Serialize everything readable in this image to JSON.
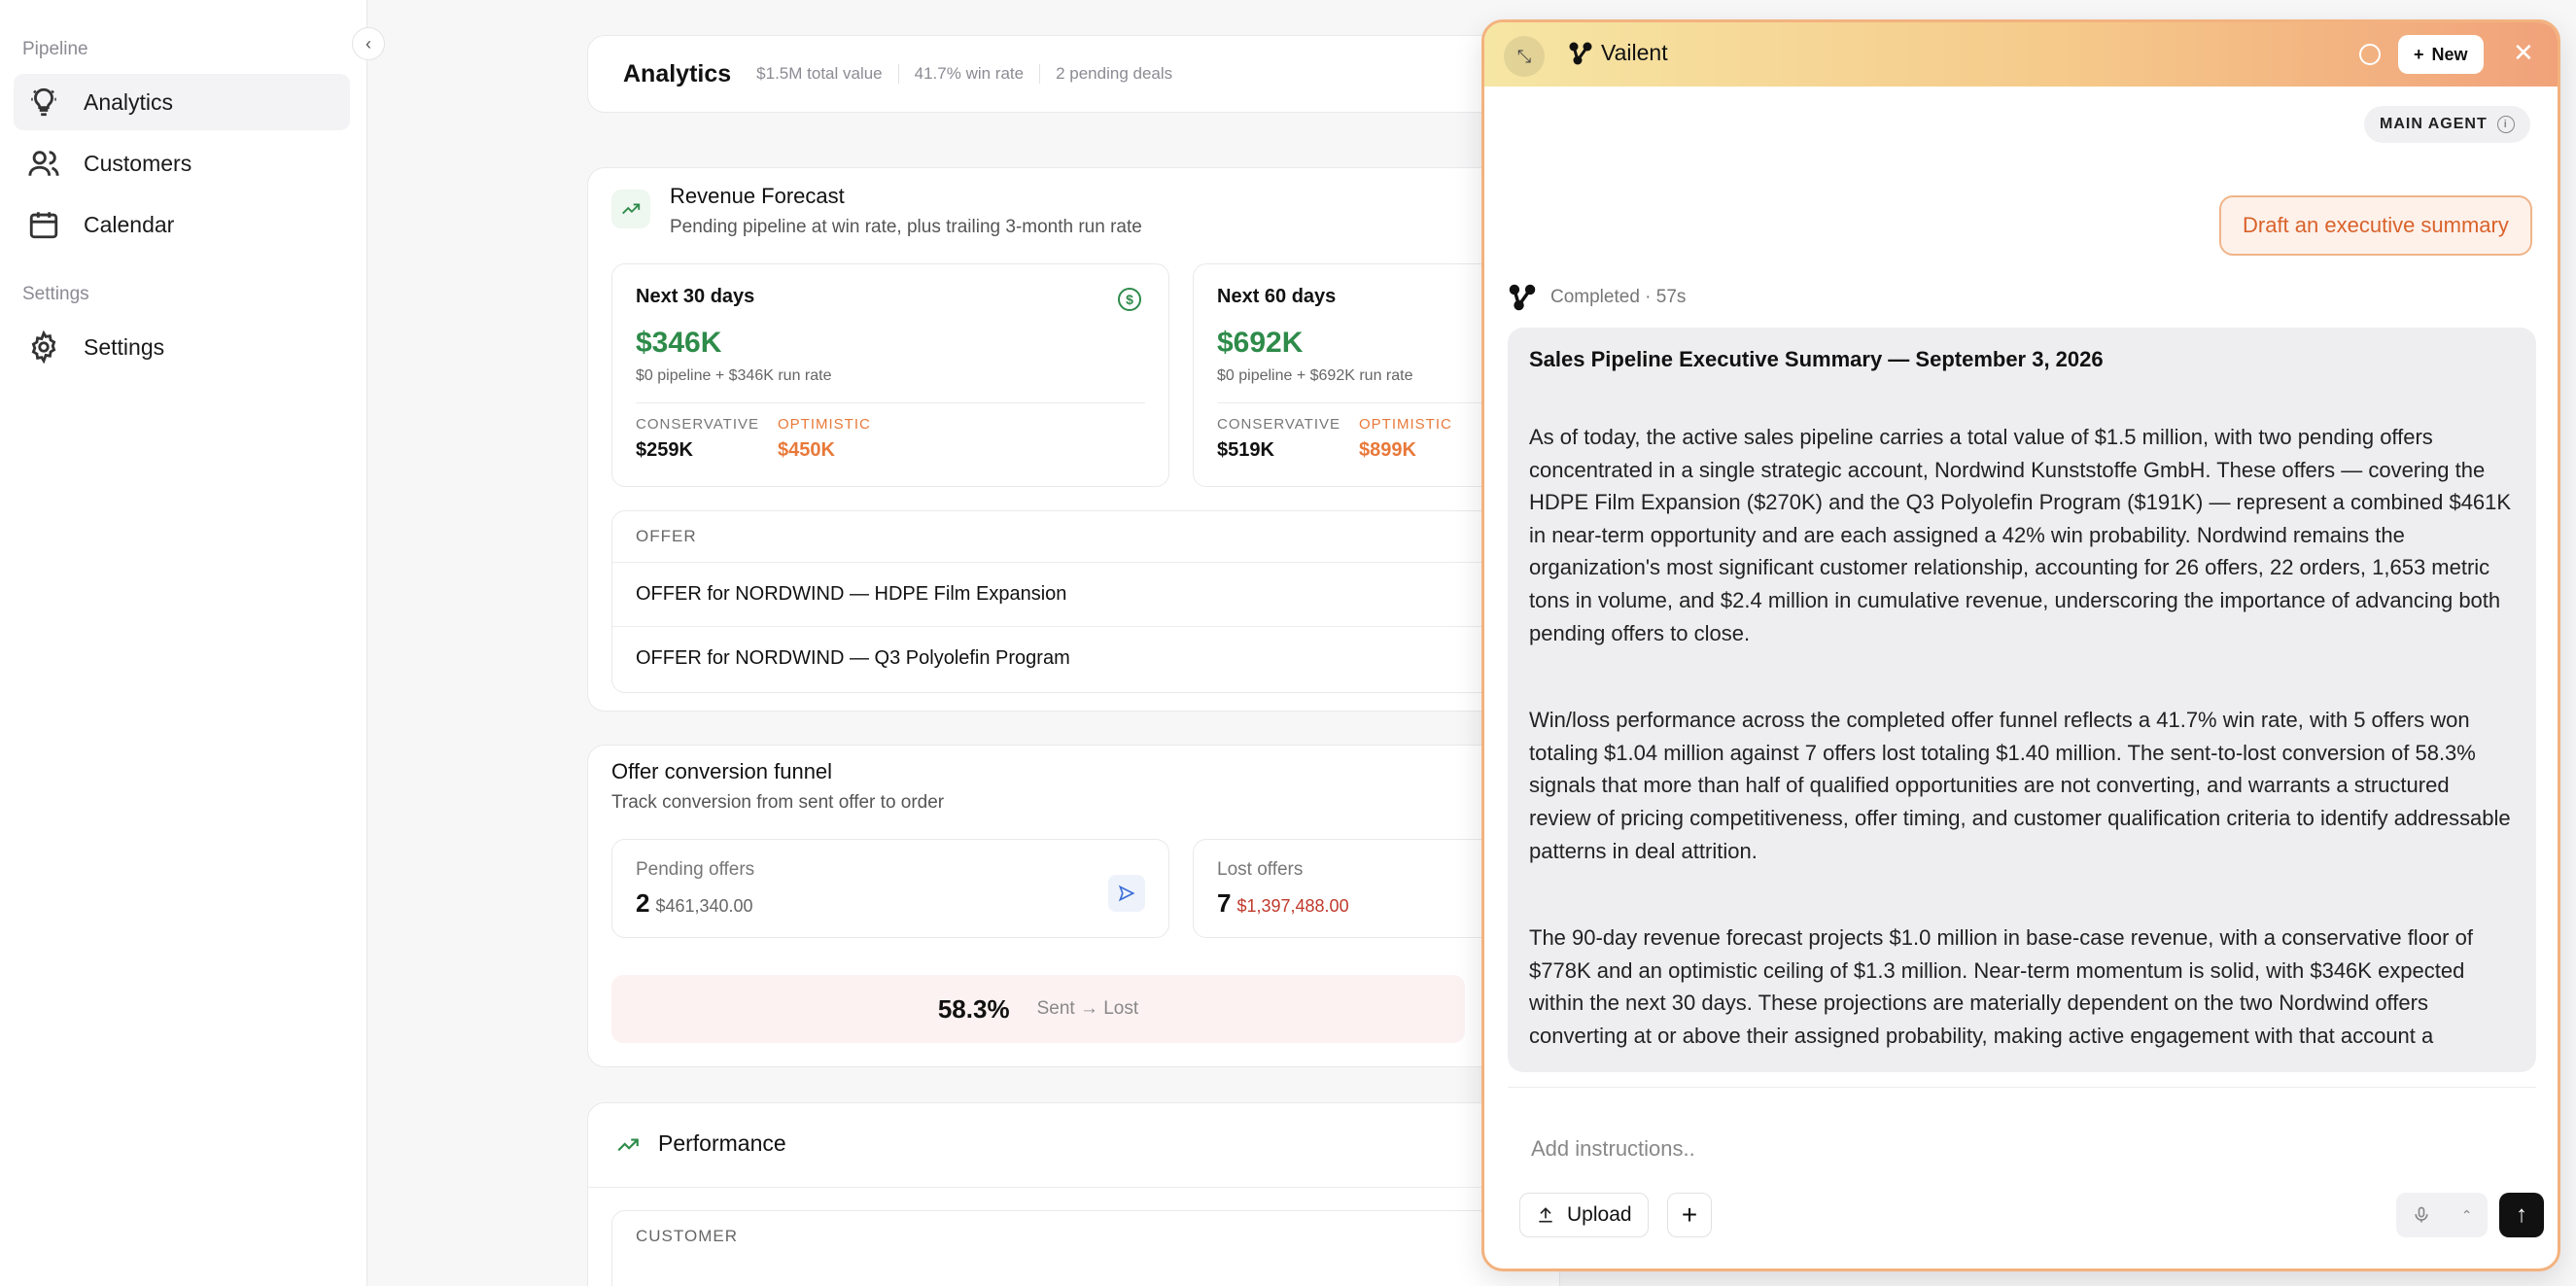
{
  "sidebar": {
    "section_pipeline": "Pipeline",
    "section_settings": "Settings",
    "items": [
      {
        "label": "Analytics",
        "icon": "lightbulb-icon"
      },
      {
        "label": "Customers",
        "icon": "users-icon"
      },
      {
        "label": "Calendar",
        "icon": "calendar-icon"
      },
      {
        "label": "Settings",
        "icon": "gear-icon"
      }
    ]
  },
  "header": {
    "title": "Analytics",
    "meta": [
      "$1.5M total value",
      "41.7% win rate",
      "2 pending deals"
    ]
  },
  "forecast": {
    "title": "Revenue Forecast",
    "subtitle": "Pending pipeline at win rate, plus trailing 3-month run rate",
    "periods": [
      {
        "title": "Next 30 days",
        "amount": "$346K",
        "note": "$0 pipeline + $346K run rate",
        "conservative_label": "CONSERVATIVE",
        "conservative": "$259K",
        "optimistic_label": "OPTIMISTIC",
        "optimistic": "$450K"
      },
      {
        "title": "Next 60 days",
        "amount": "$692K",
        "note": "$0 pipeline + $692K run rate",
        "conservative_label": "CONSERVATIVE",
        "conservative": "$519K",
        "optimistic_label": "OPTIMISTIC",
        "optimistic": "$899K"
      }
    ],
    "offer_header": "OFFER",
    "offers": [
      "OFFER for NORDWIND — HDPE Film Expansion",
      "OFFER for NORDWIND — Q3 Polyolefin Program"
    ]
  },
  "funnel": {
    "title": "Offer conversion funnel",
    "subtitle": "Track conversion from sent offer to order",
    "pending_label": "Pending offers",
    "pending_count": "2",
    "pending_amount": "$461,340.00",
    "lost_label": "Lost offers",
    "lost_count": "7",
    "lost_amount": "$1,397,488.00",
    "conversion_pct": "58.3%",
    "conversion_label": "Sent → Lost"
  },
  "performance": {
    "title": "Performance",
    "customer_header": "CUSTOMER"
  },
  "chat": {
    "brand": "Vailent",
    "new_label": "New",
    "agent_badge": "MAIN AGENT",
    "user_message": "Draft an executive summary",
    "status": "Completed · 57s",
    "answer_title": "Sales Pipeline Executive Summary — September 3, 2026",
    "paragraphs": [
      "As of today, the active sales pipeline carries a total value of $1.5 million, with two pending offers concentrated in a single strategic account, Nordwind Kunststoffe GmbH. These offers — covering the HDPE Film Expansion ($270K) and the Q3 Polyolefin Program ($191K) — represent a combined $461K in near-term opportunity and are each assigned a 42% win probability. Nordwind remains the organization's most significant customer relationship, accounting for 26 offers, 22 orders, 1,653 metric tons in volume, and $2.4 million in cumulative revenue, underscoring the importance of advancing both pending offers to close.",
      "Win/loss performance across the completed offer funnel reflects a 41.7% win rate, with 5 offers won totaling $1.04 million against 7 offers lost totaling $1.40 million. The sent-to-lost conversion of 58.3% signals that more than half of qualified opportunities are not converting, and warrants a structured review of pricing competitiveness, offer timing, and customer qualification criteria to identify addressable patterns in deal attrition.",
      "The 90-day revenue forecast projects $1.0 million in base-case revenue, with a conservative floor of $778K and an optimistic ceiling of $1.3 million. Near-term momentum is solid, with $346K expected within the next 30 days. These projections are materially dependent on the two Nordwind offers converting at or above their assigned probability, making active engagement with that account a"
    ],
    "input_placeholder": "Add instructions..",
    "upload_label": "Upload"
  },
  "colors": {
    "accent_green": "#2e8b4a",
    "accent_orange": "#e8793a",
    "lost_red": "#c0392b"
  }
}
